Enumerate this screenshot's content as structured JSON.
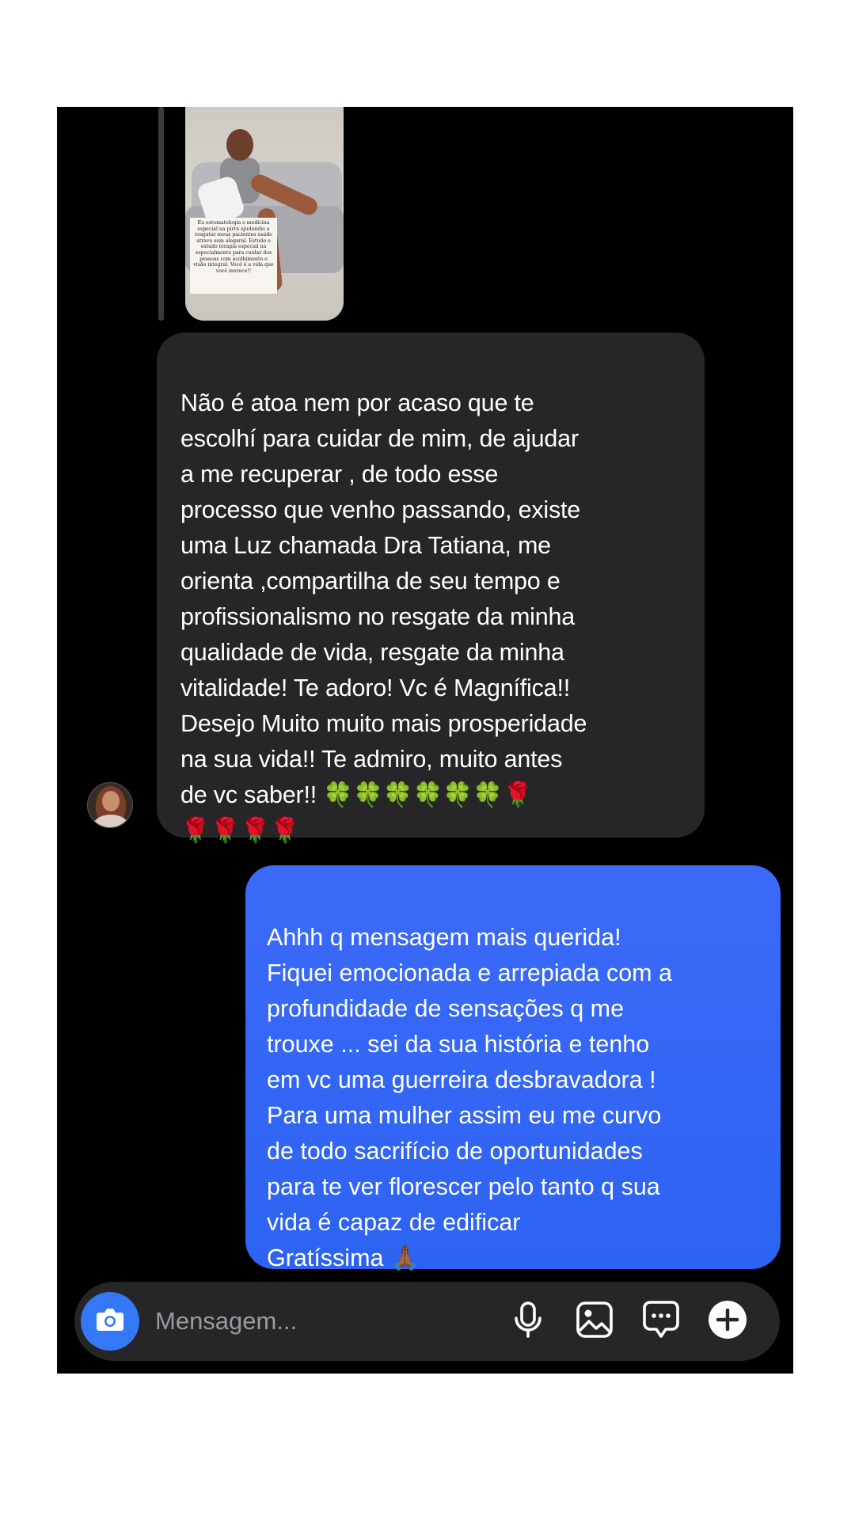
{
  "story": {
    "caption": "Eu estomatologia e medicina especial na pirra ajudandio a resgatar meus pacientes saúde atravo sem alegaral. Estudo e estudo terapia especial na especialmente para cuidar dos pessoas com acolhimento e visão integral. Você é a vida que você merece!!"
  },
  "messages": [
    {
      "direction": "incoming",
      "text": "Não é atoa nem por acaso que te\nescolhí para cuidar de mim, de ajudar\na me recuperar , de todo esse\nprocesso que venho passando, existe\numa Luz chamada Dra Tatiana, me\norienta ,compartilha  de seu tempo e\nprofissionalismo no resgate da minha\nqualidade de vida, resgate da minha\nvitalidade! Te adoro! Vc é Magnífica!!\nDesejo Muito muito mais prosperidade\nna sua vida!! Te admiro, muito antes\nde vc saber!! 🍀🍀🍀🍀🍀🍀🌹\n🌹🌹🌹🌹"
    },
    {
      "direction": "outgoing",
      "text": "Ahhh q mensagem mais querida!\nFiquei emocionada e arrepiada com a\nprofundidade de sensações q me\ntrouxe ... sei da sua história e tenho\nem vc uma guerreira desbravadora !\nPara uma mulher assim eu me curvo\nde todo sacrifício de oportunidades\npara te ver florescer pelo tanto q sua\nvida é capaz de edificar\nGratíssima 🙏🏾"
    }
  ],
  "composer": {
    "placeholder": "Mensagem...",
    "icons": [
      "camera-icon",
      "microphone-icon",
      "gallery-icon",
      "sticker-icon",
      "plus-icon"
    ],
    "camera_color": "#3478f6"
  },
  "colors": {
    "incoming_bubble": "#262628",
    "outgoing_bubble": "#2d63f2",
    "background": "#000000"
  }
}
